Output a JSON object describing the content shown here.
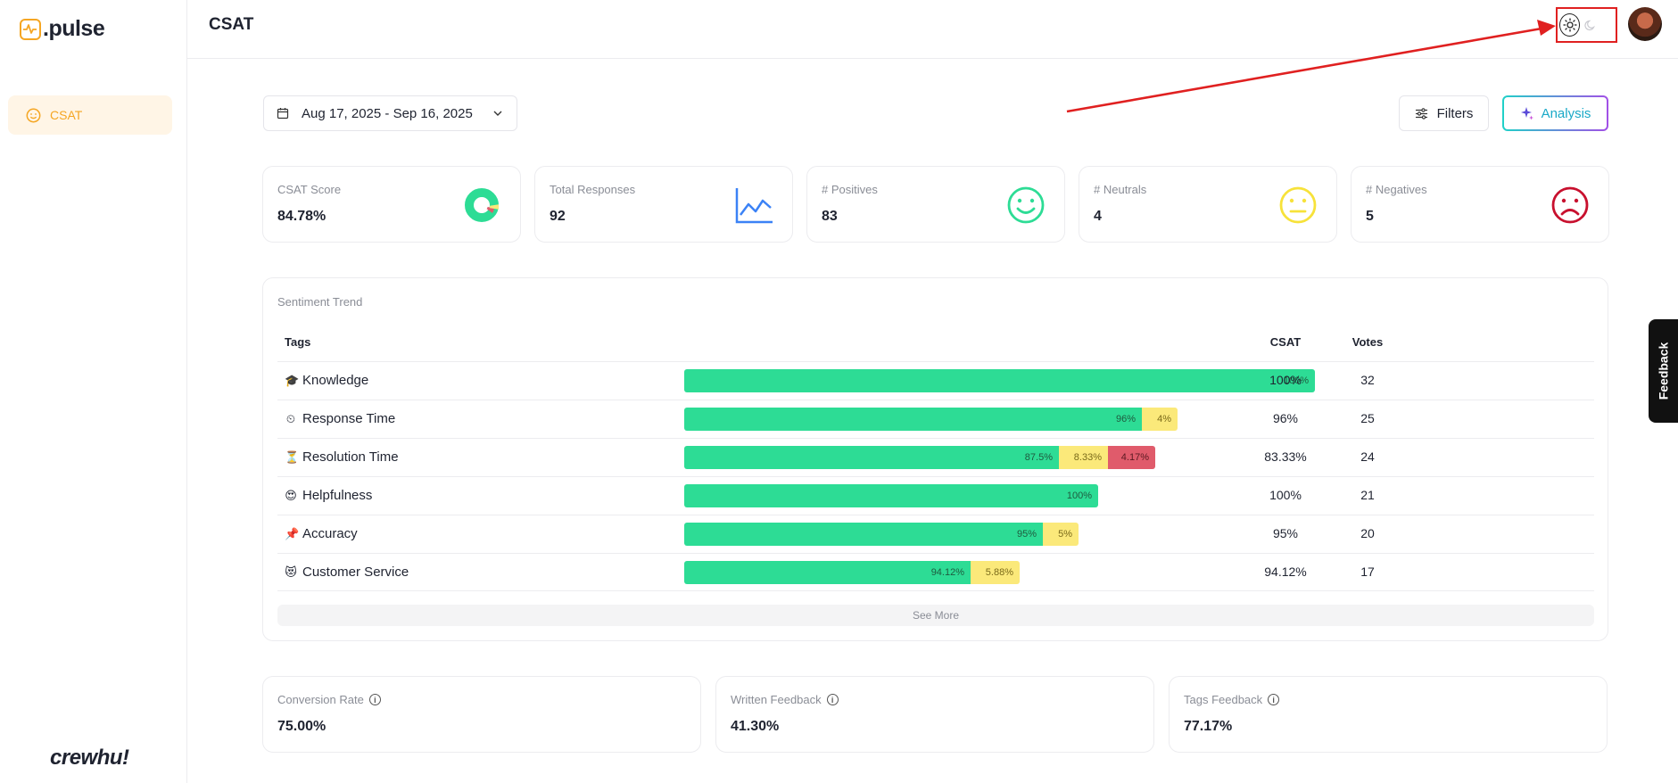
{
  "app": {
    "logo_text": ".pulse",
    "brand_bottom": "crewhu!"
  },
  "sidebar": {
    "items": [
      {
        "label": "CSAT",
        "icon": "smile-icon"
      }
    ]
  },
  "header": {
    "title": "CSAT"
  },
  "toolbar": {
    "date_range": "Aug 17, 2025 - Sep 16, 2025",
    "filters_label": "Filters",
    "analysis_label": "Analysis"
  },
  "stats": [
    {
      "label": "CSAT Score",
      "value": "84.78%",
      "icon": "donut-chart-icon"
    },
    {
      "label": "Total Responses",
      "value": "92",
      "icon": "line-chart-icon"
    },
    {
      "label": "# Positives",
      "value": "83",
      "icon": "happy-face-icon"
    },
    {
      "label": "# Neutrals",
      "value": "4",
      "icon": "neutral-face-icon"
    },
    {
      "label": "# Negatives",
      "value": "5",
      "icon": "sad-face-icon"
    }
  ],
  "trend": {
    "title": "Sentiment Trend",
    "headers": {
      "tags": "Tags",
      "csat": "CSAT",
      "votes": "Votes"
    },
    "see_more": "See More",
    "rows": [
      {
        "tag": "Knowledge",
        "emoji": "🎓",
        "pos": "100%",
        "neu": "",
        "neg": "",
        "csat": "100%",
        "votes": "32"
      },
      {
        "tag": "Response Time",
        "emoji": "⏲",
        "pos": "96%",
        "neu": "4%",
        "neg": "",
        "csat": "96%",
        "votes": "25"
      },
      {
        "tag": "Resolution Time",
        "emoji": "⏳",
        "pos": "87.5%",
        "neu": "8.33%",
        "neg": "4.17%",
        "csat": "83.33%",
        "votes": "24"
      },
      {
        "tag": "Helpfulness",
        "emoji": "😍",
        "pos": "100%",
        "neu": "",
        "neg": "",
        "csat": "100%",
        "votes": "21"
      },
      {
        "tag": "Accuracy",
        "emoji": "📌",
        "pos": "95%",
        "neu": "5%",
        "neg": "",
        "csat": "95%",
        "votes": "20"
      },
      {
        "tag": "Customer Service",
        "emoji": "😻",
        "pos": "94.12%",
        "neu": "5.88%",
        "neg": "",
        "csat": "94.12%",
        "votes": "17"
      }
    ]
  },
  "metrics": [
    {
      "label": "Conversion Rate",
      "value": "75.00%"
    },
    {
      "label": "Written Feedback",
      "value": "41.30%"
    },
    {
      "label": "Tags Feedback",
      "value": "77.17%"
    }
  ],
  "feedback_tab": {
    "label": "Feedback"
  },
  "colors": {
    "accent": "#f5a623",
    "positive": "#2ddc95",
    "neutral": "#fbe97a",
    "negative": "#e05b6b",
    "annotation": "#e02020"
  }
}
